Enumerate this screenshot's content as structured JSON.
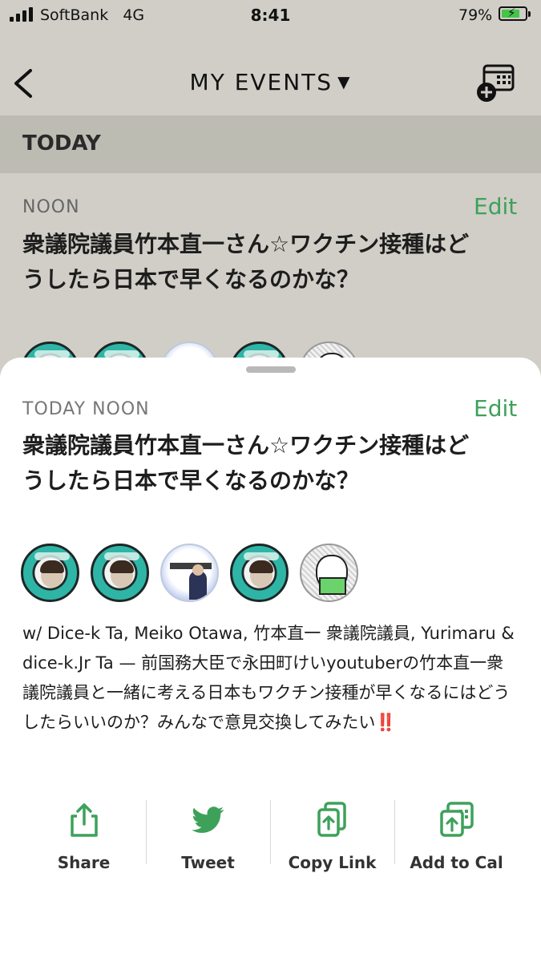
{
  "status": {
    "carrier": "SoftBank",
    "network": "4G",
    "time": "8:41",
    "battery": "79%",
    "battery_level": 0.79
  },
  "nav": {
    "title": "MY EVENTS",
    "caret": "▼",
    "back_icon": "chevron-left-icon",
    "add_calendar_icon": "calendar-plus-icon"
  },
  "section": {
    "title": "TODAY"
  },
  "background_event": {
    "time": "NOON",
    "edit": "Edit",
    "title": "衆議院議員竹本直一さん☆ワクチン接種はどうしたら日本で早くなるのかな？"
  },
  "sheet": {
    "time": "TODAY NOON",
    "edit": "Edit",
    "title": "衆議院議員竹本直一さん☆ワクチン接種はどうしたら日本で早くなるのかな？",
    "description": "w/ Dice-k Ta, Meiko Otawa, 竹本直一 衆議院議員, Yurimaru & dice-k.Jr Ta — 前国務大臣で永田町けいyoutuberの竹本直一衆議院議員と一緒に考える日本もワクチン接種が早くなるにはどうしたらいいのか？みんなで意見交換してみたい",
    "description_emoji": "‼️",
    "participants": [
      "Dice-k Ta",
      "Meiko Otawa",
      "竹本直一 衆議院議員",
      "Yurimaru",
      "dice-k.Jr Ta"
    ]
  },
  "actions": [
    {
      "label": "Share",
      "icon": "share-icon"
    },
    {
      "label": "Tweet",
      "icon": "twitter-bird-icon"
    },
    {
      "label": "Copy Link",
      "icon": "copy-link-icon"
    },
    {
      "label": "Add to Cal",
      "icon": "add-to-calendar-icon"
    }
  ],
  "colors": {
    "accent": "#3da15a",
    "background": "#d0cec7",
    "section": "#bcbcb3"
  }
}
